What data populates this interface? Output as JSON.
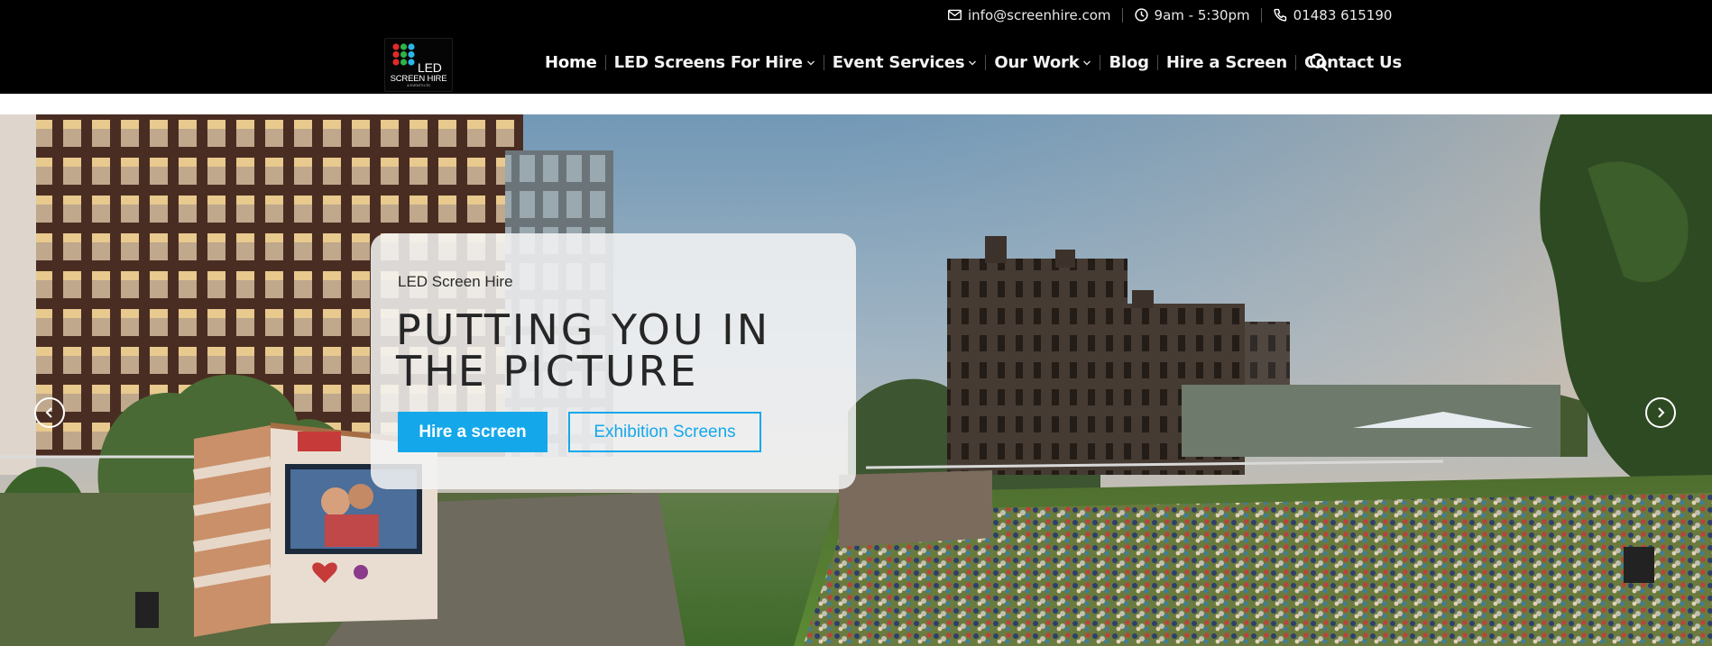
{
  "header": {
    "contact": {
      "email": "info@screenhire.com",
      "hours": "9am - 5:30pm",
      "phone": "01483 615190"
    },
    "logo": {
      "line1": "LED",
      "line2": "SCREEN HIRE",
      "tagline": "& EVENTS LTD"
    },
    "nav": [
      {
        "label": "Home",
        "active": true,
        "has_dropdown": false
      },
      {
        "label": "LED Screens For Hire",
        "active": false,
        "has_dropdown": true
      },
      {
        "label": "Event Services",
        "active": false,
        "has_dropdown": true
      },
      {
        "label": "Our Work",
        "active": false,
        "has_dropdown": true
      },
      {
        "label": "Blog",
        "active": false,
        "has_dropdown": false
      },
      {
        "label": "Hire a Screen",
        "active": false,
        "has_dropdown": false
      },
      {
        "label": "Contact Us",
        "active": false,
        "has_dropdown": false
      }
    ]
  },
  "hero": {
    "eyebrow": "LED Screen Hire",
    "heading": "PUTTING YOU IN THE PICTURE",
    "primary_button": "Hire a screen",
    "secondary_button": "Exhibition Screens"
  },
  "colors": {
    "header_bg": "#000000",
    "accent": "#14a8ea",
    "card_bg": "#f4f4f4"
  },
  "icons": [
    "mail-icon",
    "clock-icon",
    "phone-icon",
    "search-icon",
    "chevron-left-icon",
    "chevron-right-icon",
    "chevron-down-icon"
  ]
}
